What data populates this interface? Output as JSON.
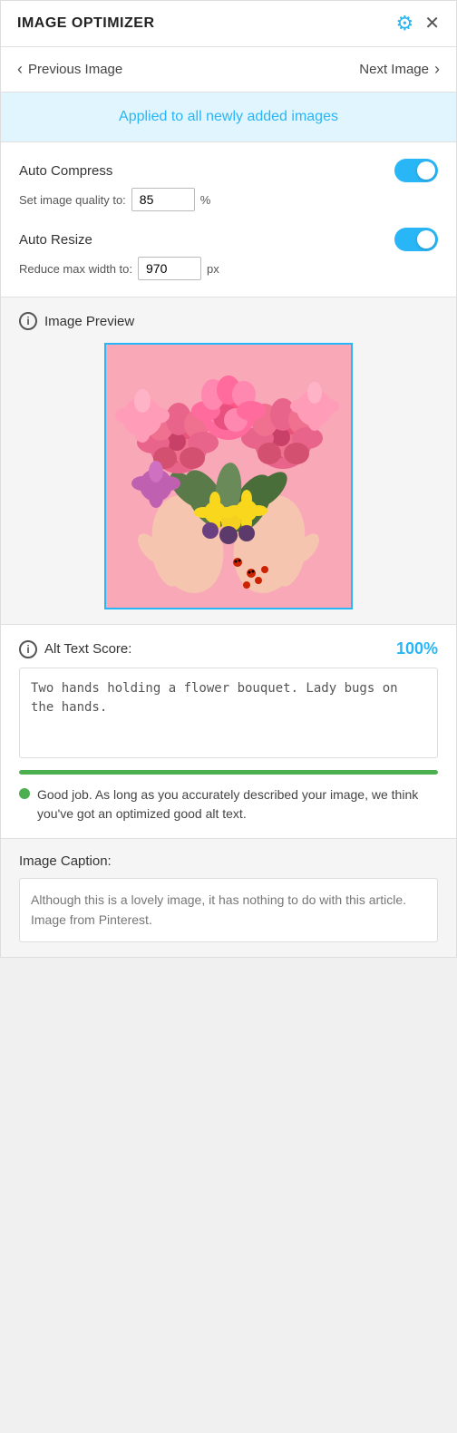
{
  "header": {
    "title": "IMAGE OPTIMIZER",
    "gear_icon": "⚙",
    "close_icon": "✕"
  },
  "navigation": {
    "prev_label": "Previous Image",
    "next_label": "Next Image",
    "prev_arrow": "‹",
    "next_arrow": "›"
  },
  "banner": {
    "text": "Applied to all newly added images"
  },
  "settings": {
    "auto_compress": {
      "label": "Auto Compress",
      "input_prefix": "Set image quality to:",
      "value": "85",
      "unit": "%",
      "toggle_on": true
    },
    "auto_resize": {
      "label": "Auto Resize",
      "input_prefix": "Reduce max width to:",
      "value": "970",
      "unit": "px",
      "toggle_on": true
    }
  },
  "preview": {
    "label": "Image Preview",
    "info_icon": "i"
  },
  "alt_text": {
    "label": "Alt Text Score:",
    "score": "100%",
    "info_icon": "i",
    "text": "Two hands holding a flower bouquet. Lady bugs on the hands.",
    "progress": 100,
    "good_job_message": "Good job. As long as you accurately described your image, we think you've got an optimized good alt text."
  },
  "caption": {
    "label": "Image Caption:",
    "text": "Although this is a lovely image, it has nothing to do with this article. Image from Pinterest."
  },
  "colors": {
    "accent": "#29b6f6",
    "green": "#4caf50",
    "banner_bg": "#e1f5fe"
  }
}
